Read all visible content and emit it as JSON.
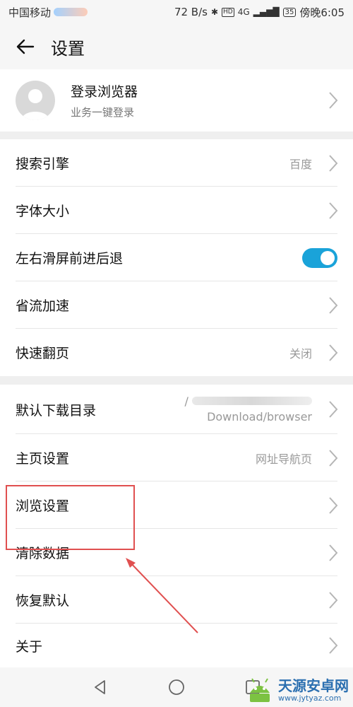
{
  "status_bar": {
    "carrier": "中国移动",
    "speed": "72 B/s",
    "hd_badge": "HD",
    "network": "4G",
    "battery": "35",
    "time": "傍晚6:05"
  },
  "app_bar": {
    "title": "设置"
  },
  "account": {
    "title": "登录浏览器",
    "subtitle": "业务一键登录"
  },
  "group1": [
    {
      "label": "搜索引擎",
      "value": "百度"
    },
    {
      "label": "字体大小",
      "value": ""
    },
    {
      "label": "左右滑屏前进后退",
      "toggle": true
    },
    {
      "label": "省流加速",
      "value": ""
    },
    {
      "label": "快速翻页",
      "value": "关闭"
    }
  ],
  "group2": [
    {
      "label": "默认下载目录",
      "value_prefix": "/",
      "value_line2": "Download/browser"
    },
    {
      "label": "主页设置",
      "value": "网址导航页"
    },
    {
      "label": "浏览设置",
      "value": ""
    },
    {
      "label": "清除数据",
      "value": ""
    },
    {
      "label": "恢复默认",
      "value": ""
    },
    {
      "label": "关于",
      "value": ""
    }
  ],
  "watermark": {
    "name": "天源安卓网",
    "url": "www.jytyaz.com"
  },
  "colors": {
    "toggle_on": "#1aa3d9",
    "annotation": "#e05050"
  }
}
